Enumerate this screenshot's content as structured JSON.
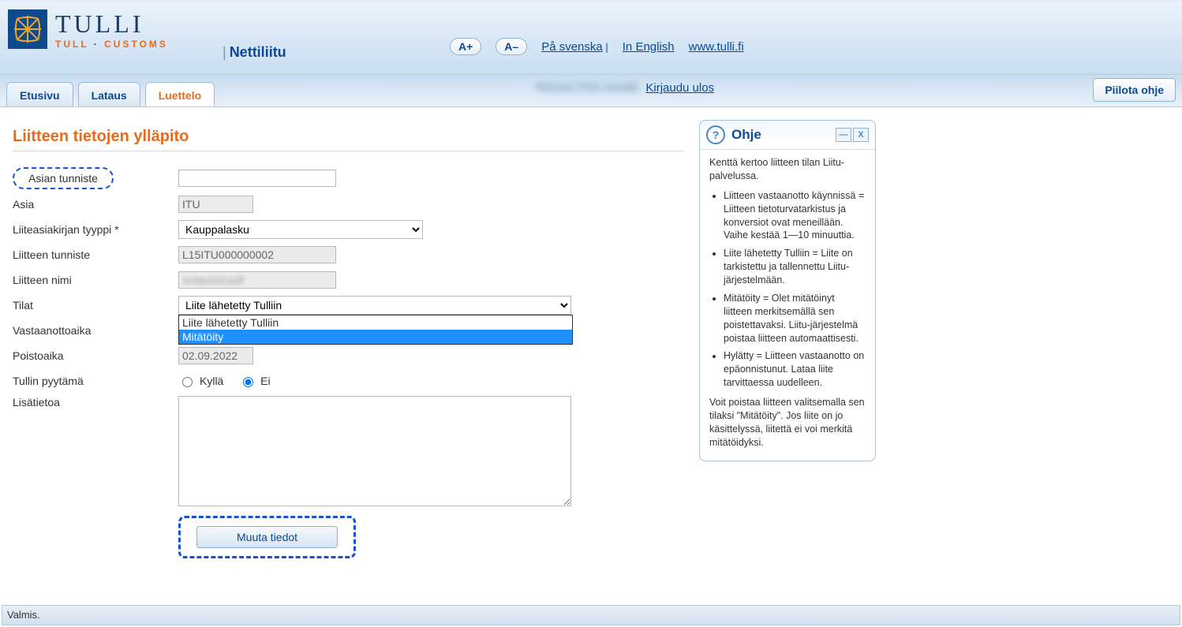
{
  "header": {
    "brand_main": "TULLI",
    "brand_sub_a": "TULL",
    "brand_sub_b": "CUSTOMS",
    "app_name": "Nettiliitu",
    "zoom_in": "A+",
    "zoom_out": "A–",
    "lang_sv": "På svenska",
    "lang_en": "In English",
    "site_link": "www.tulli.fi"
  },
  "tabs": {
    "etusivu": "Etusivu",
    "lataus": "Lataus",
    "luettelo": "Luettelo"
  },
  "user": {
    "redacted": "REDACTED NAME",
    "logout": "Kirjaudu ulos"
  },
  "hide_help_btn": "Piilota ohje",
  "page_title": "Liitteen tietojen ylläpito",
  "form": {
    "asian_tunniste_label": "Asian tunniste",
    "asian_tunniste_value": "",
    "asia_label": "Asia",
    "asia_value": "ITU",
    "tyyppi_label": "Liiteasiakirjan tyyppi *",
    "tyyppi_value": "Kauppalasku",
    "liite_tunniste_label": "Liitteen tunniste",
    "liite_tunniste_value": "L15ITU000000002",
    "liite_nimi_label": "Liitteen nimi",
    "liite_nimi_value": "",
    "tilat_label": "Tilat",
    "tilat_value": "Liite lähetetty Tulliin",
    "tilat_options": [
      "Liite lähetetty Tulliin",
      "Mitätöity"
    ],
    "vastaanotto_label": "Vastaanottoaika",
    "poisto_label": "Poistoaika",
    "poisto_value": "02.09.2022",
    "pyytama_label": "Tullin pyytämä",
    "radio_kylla": "Kyllä",
    "radio_ei": "Ei",
    "lisatietoa_label": "Lisätietoa",
    "lisatietoa_value": "",
    "submit": "Muuta tiedot"
  },
  "help": {
    "title": "Ohje",
    "intro": "Kenttä kertoo liitteen tilan Liitu-palvelussa.",
    "items": [
      "Liitteen vastaanotto käynnissä = Liitteen tietoturvatarkistus ja konversiot ovat meneillään. Vaihe kestää 1—10 minuuttia.",
      "Liite lähetetty Tulliin = Liite on tarkistettu ja tallennettu Liitu-järjestelmään.",
      "Mitätöity = Olet mitätöinyt liitteen merkitsemällä sen poistettavaksi. Liitu-järjestelmä poistaa liitteen automaattisesti.",
      "Hylätty = Liitteen vastaanotto on epäonnistunut. Lataa liite tarvittaessa uudelleen."
    ],
    "outro": "Voit poistaa liitteen valitsemalla sen tilaksi \"Mitätöity\". Jos liite on jo käsittelyssä, liitettä ei voi merkitä mitätöidyksi."
  },
  "status_bar": "Valmis."
}
